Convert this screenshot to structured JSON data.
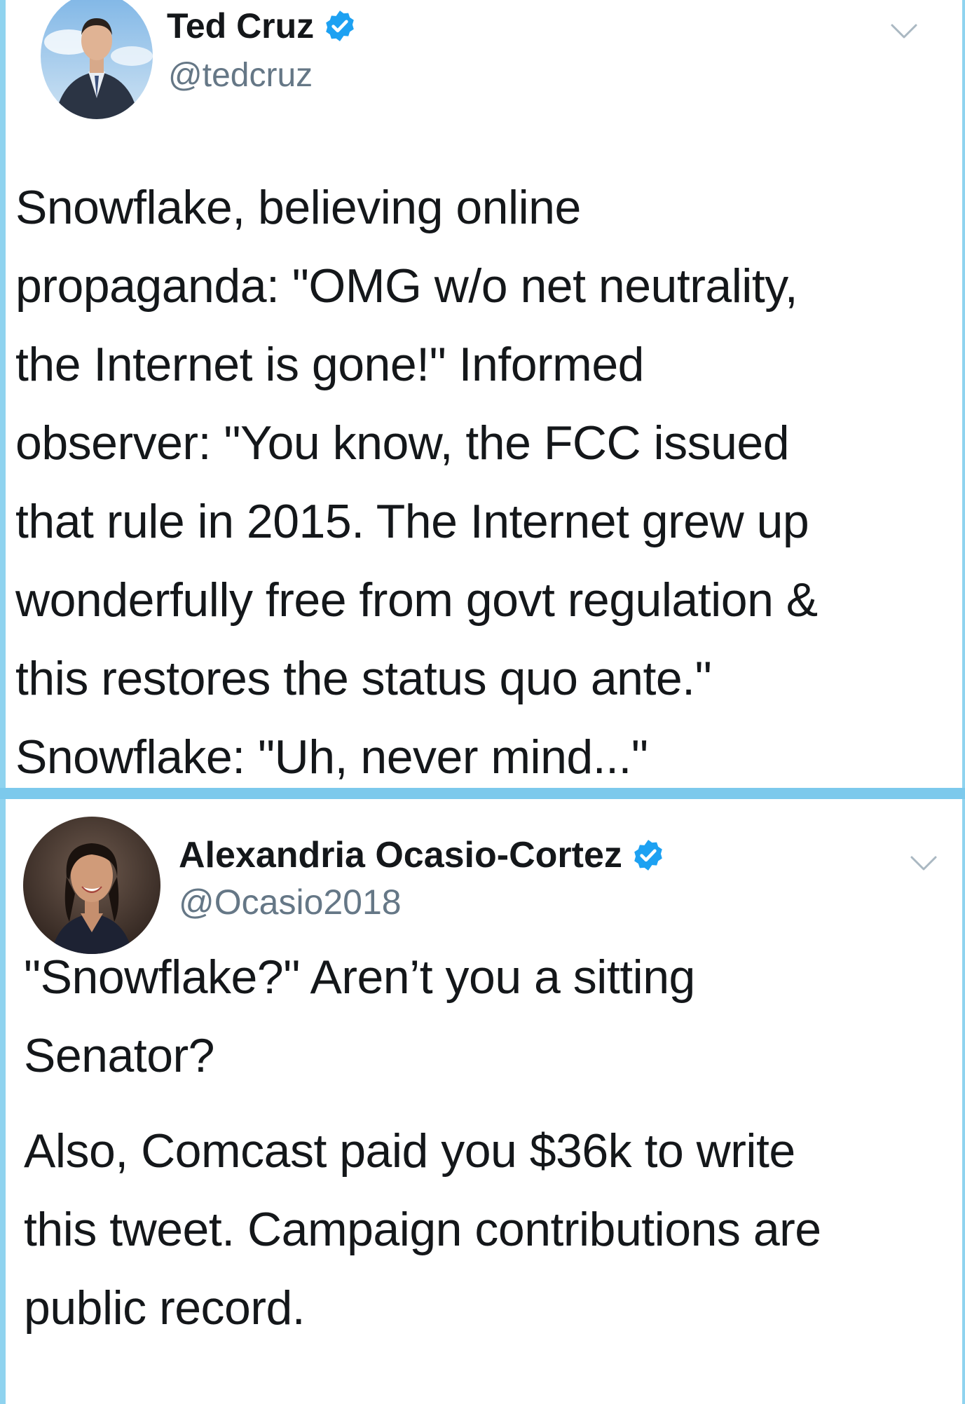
{
  "tweets": [
    {
      "author_name": "Ted Cruz",
      "handle": "@tedcruz",
      "verified": true,
      "avatar_icon": "profile-photo-man-suit",
      "menu_icon": "chevron-down-icon",
      "text_lines": [
        "Snowflake, believing online",
        "propaganda: \"OMG w/o net neutrality,",
        "the Internet is gone!\" Informed",
        "observer: \"You know, the FCC issued",
        "that rule in 2015. The Internet grew up",
        "wonderfully free from govt regulation &",
        "this restores the status quo ante.\"",
        "Snowflake: \"Uh, never mind...\""
      ]
    },
    {
      "author_name": "Alexandria Ocasio-Cortez",
      "handle": "@Ocasio2018",
      "verified": true,
      "avatar_icon": "profile-photo-woman",
      "menu_icon": "chevron-down-icon",
      "paragraphs": [
        [
          "\"Snowflake?\" Aren’t you a sitting",
          "Senator?"
        ],
        [
          "Also, Comcast paid you $36k to write",
          "this tweet. Campaign contributions are",
          "public record."
        ]
      ]
    }
  ],
  "colors": {
    "frame": "#8fd3ef",
    "divider": "#7cc9ec",
    "verified_badge": "#1da1f2",
    "handle_text": "#657786",
    "body_text": "#14171a"
  }
}
